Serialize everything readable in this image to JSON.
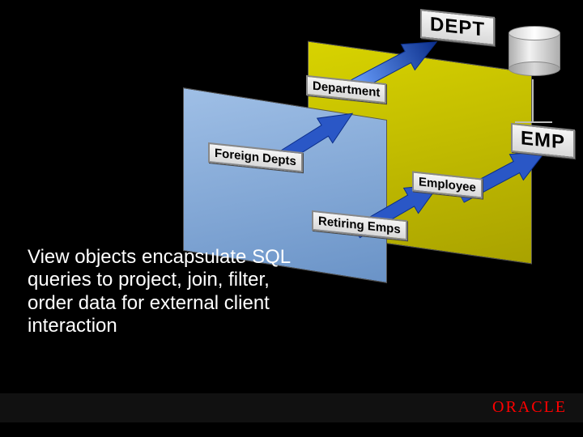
{
  "caption": "View objects encapsulate SQL queries to project, join, filter, order data for external client interaction",
  "brand": "ORACLE",
  "tags": {
    "dept": "DEPT",
    "emp": "EMP",
    "department": "Department",
    "foreign_depts": "Foreign Depts",
    "employee": "Employee",
    "retiring_emps": "Retiring Emps"
  },
  "icons": {
    "database": "cylinder-icon",
    "arrow": "arrow-icon"
  },
  "colors": {
    "panel_back": "#b3ab00",
    "panel_front": "#7fa4d3",
    "arrow": "#2a57c6",
    "brand": "#ff0000"
  }
}
